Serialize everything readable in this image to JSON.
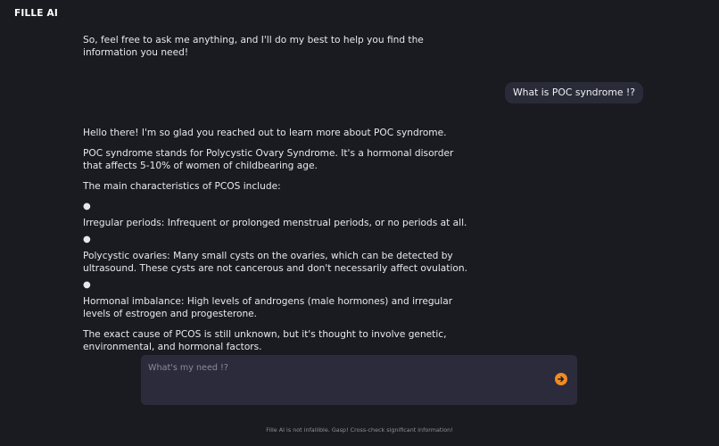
{
  "header": {
    "brand": "FILLE AI"
  },
  "messages": {
    "ai_intro_tail": {
      "text": "So, feel free to ask me anything, and I'll do my best to help you find the information you need!"
    },
    "user_question": {
      "text": "What is POC syndrome !?"
    },
    "ai_answer": {
      "greeting": "Hello there! I'm so glad you reached out to learn more about POC syndrome.",
      "definition": "POC syndrome stands for Polycystic Ovary Syndrome. It's a hormonal disorder that affects 5-10% of women of childbearing age.",
      "characteristics_intro": "The main characteristics of PCOS include:",
      "bullets": [
        "Irregular periods: Infrequent or prolonged menstrual periods, or no periods at all.",
        "Polycystic ovaries: Many small cysts on the ovaries, which can be detected by ultrasound. These cysts are not cancerous and don't necessarily affect ovulation.",
        "Hormonal imbalance: High levels of androgens (male hormones) and irregular levels of estrogen and progesterone."
      ],
      "cause": "The exact cause of PCOS is still unknown, but it's thought to involve genetic, environmental, and hormonal factors."
    }
  },
  "composer": {
    "placeholder": "What's my need !?",
    "value": "",
    "send_icon": "arrow-right-circle-icon",
    "accent_color": "#f08a24"
  },
  "footer": {
    "disclaimer": "Fille AI is not infallible. Gasp! Cross-check significant information!"
  },
  "colors": {
    "background": "#1a1b21",
    "user_bubble": "#2a2b38",
    "composer_bg": "#2b2b3b"
  }
}
